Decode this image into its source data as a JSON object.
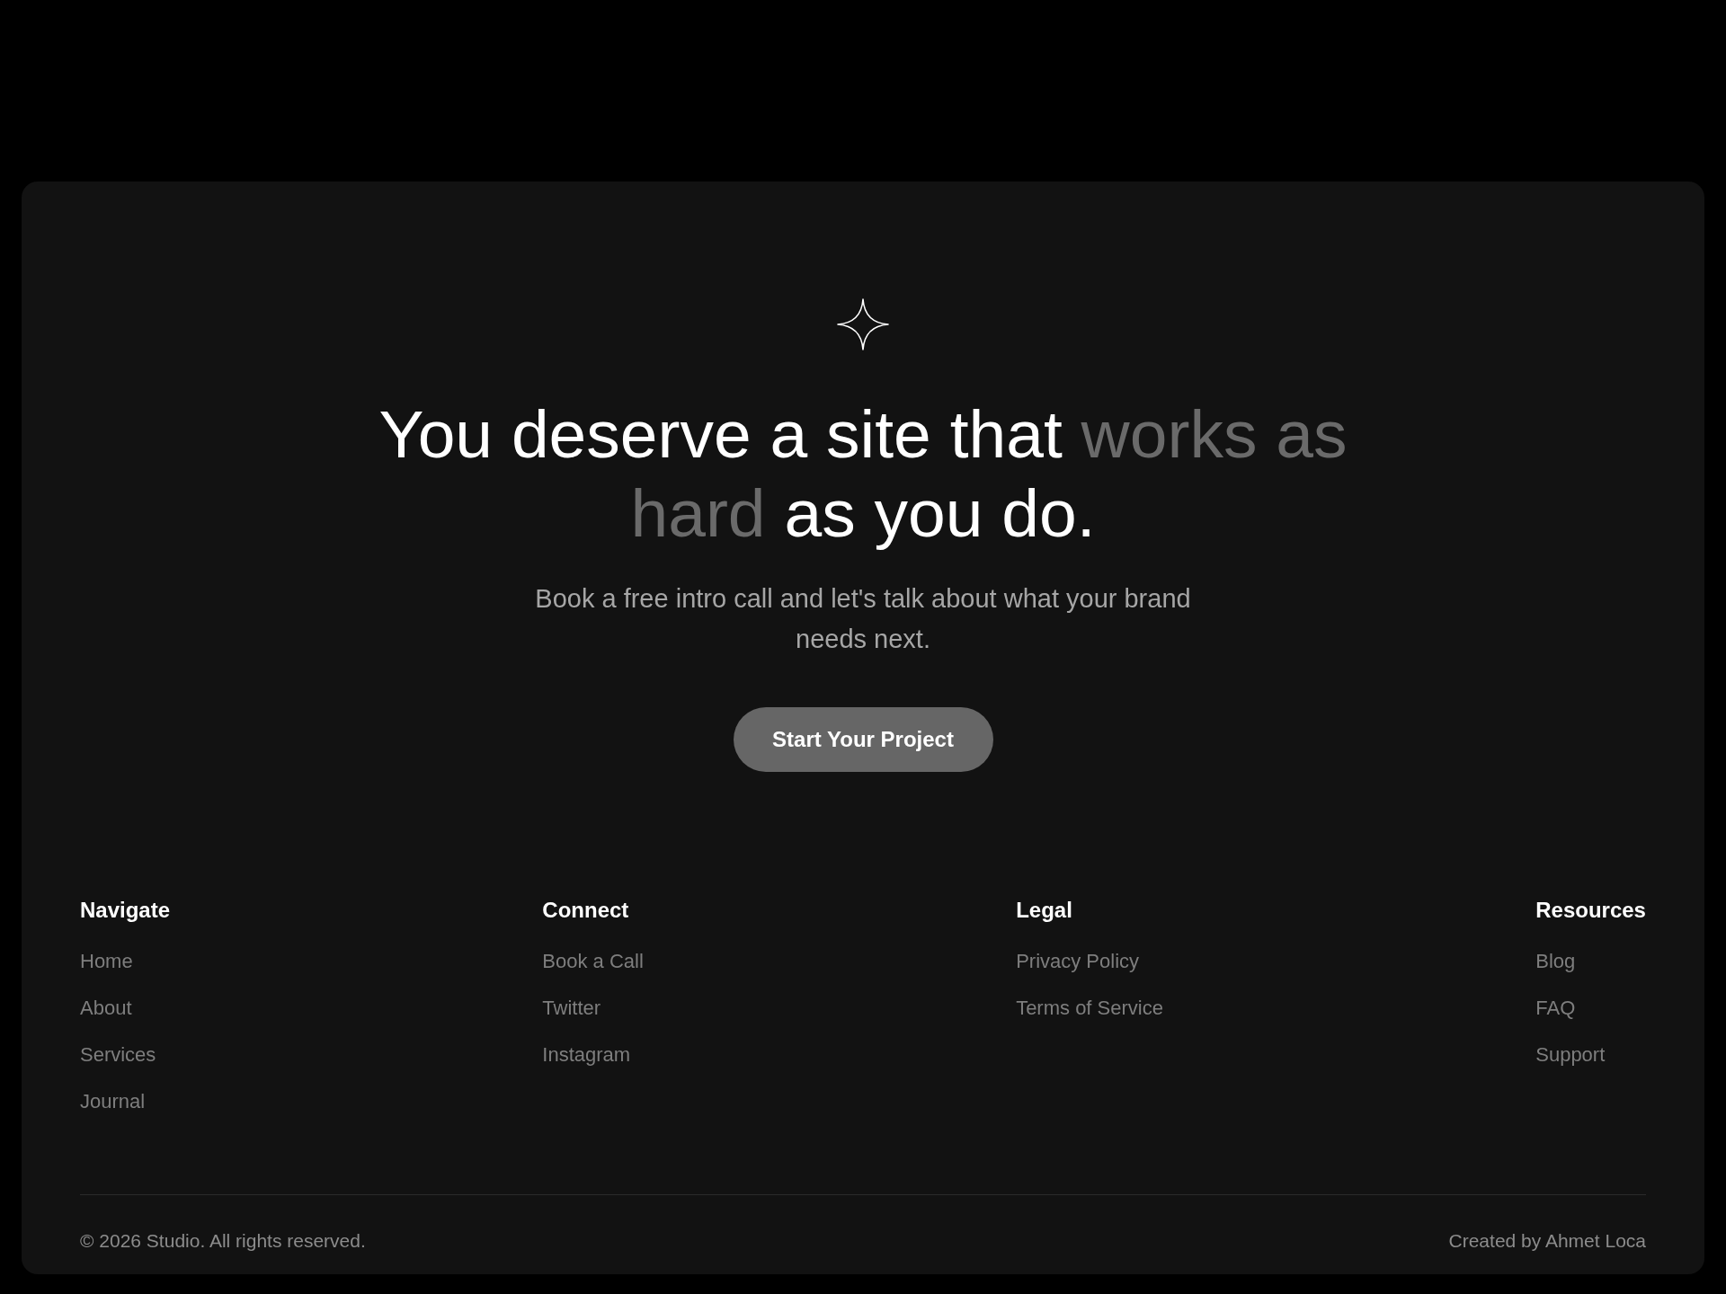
{
  "hero": {
    "headline": [
      {
        "text": "You deserve a site that ",
        "muted": false
      },
      {
        "text": "works as hard",
        "muted": true
      },
      {
        "text": " as you do.",
        "muted": false
      }
    ],
    "subtitle": "Book a free intro call and let's talk about what your brand needs next.",
    "cta": "Start Your Project"
  },
  "footer": {
    "columns": [
      {
        "heading": "Navigate",
        "links": [
          "Home",
          "About",
          "Services",
          "Journal"
        ]
      },
      {
        "heading": "Connect",
        "links": [
          "Book a Call",
          "Twitter",
          "Instagram"
        ]
      },
      {
        "heading": "Legal",
        "links": [
          "Privacy Policy",
          "Terms of Service"
        ]
      },
      {
        "heading": "Resources",
        "links": [
          "Blog",
          "FAQ",
          "Support"
        ]
      }
    ],
    "copyright": "© 2026 Studio. All rights reserved.",
    "credit": "Created by Ahmet Loca"
  }
}
